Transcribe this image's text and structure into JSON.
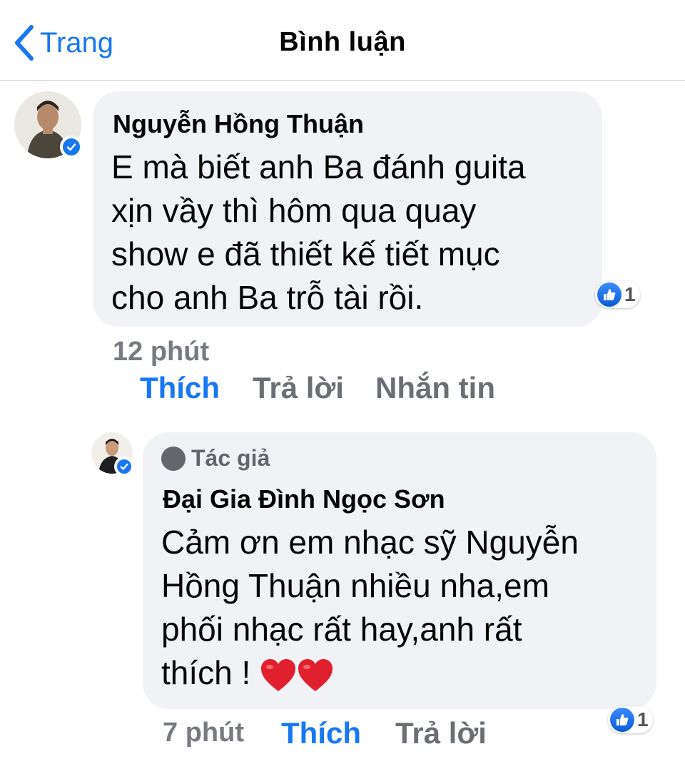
{
  "header": {
    "back_label": "Trang",
    "title": "Bình luận"
  },
  "comments": [
    {
      "author": "Nguyễn Hồng Thuận",
      "verified": true,
      "lines": [
        "E mà biết anh Ba đánh guita",
        "xịn vầy thì hôm qua quay",
        "show e đã thiết kế tiết mục",
        "cho anh Ba trỗ tài rồi."
      ],
      "reaction_icon": "like-icon",
      "reaction_count": "1",
      "time": "12 phút",
      "actions": {
        "like": "Thích",
        "reply": "Trả lời",
        "message": "Nhắn tin"
      },
      "liked": true
    },
    {
      "badge": "Tác giả",
      "author": "Đại Gia Đình Ngọc Sơn",
      "verified": true,
      "lines": [
        "Cảm ơn em nhạc sỹ Nguyễn",
        "Hồng Thuận nhiều nha,em",
        "phối nhạc rất hay,anh rất",
        "thích !"
      ],
      "trailing_emoji": "red-heart-icon x2",
      "reaction_icon": "like-icon",
      "reaction_count": "1",
      "time": "7 phút",
      "actions": {
        "like": "Thích",
        "reply": "Trả lời"
      },
      "liked": true
    }
  ],
  "colors": {
    "accent": "#1877f2",
    "bubble": "#f0f2f5",
    "meta_text": "#777b80",
    "heart": "#e0202e"
  }
}
